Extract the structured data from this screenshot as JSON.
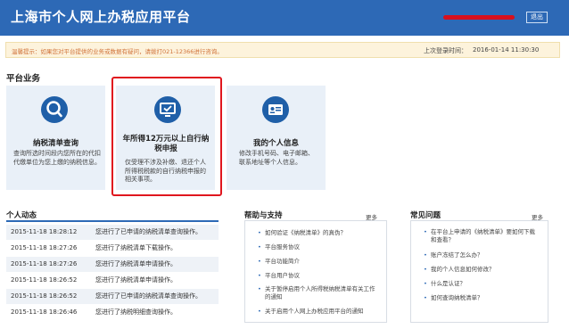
{
  "header": {
    "title": "上海市个人网上办税应用平台",
    "logout": "退出"
  },
  "notice": {
    "message": "温馨提示：如果您对平台提供的业务或数据有疑问，请拨打021-12366进行咨询。",
    "last_login_label": "上次登录时间：",
    "last_login_time": "2016-01-14 11:30:30"
  },
  "section_title": "平台业务",
  "cards": [
    {
      "title": "纳税清单查询",
      "desc": "查询所选时间段内您所在的代扣代缴单位为您上缴的纳税信息。",
      "icon": "magnifier-icon"
    },
    {
      "title": "年所得12万元以上自行纳税申报",
      "desc": "仅受理不涉及补缴、退还个人所得税税款的自行纳税申报的相关事项。",
      "icon": "monitor-check-icon"
    },
    {
      "title": "我的个人信息",
      "desc": "修改手机号码、电子邮箱、联系地址等个人信息。",
      "icon": "id-card-icon"
    }
  ],
  "activity": {
    "title": "个人动态",
    "rows": [
      {
        "time": "2015-11-18 18:28:12",
        "text": "您进行了已申请的纳税清单查询操作。"
      },
      {
        "time": "2015-11-18 18:27:26",
        "text": "您进行了纳税清单下载操作。"
      },
      {
        "time": "2015-11-18 18:27:26",
        "text": "您进行了纳税清单申请操作。"
      },
      {
        "time": "2015-11-18 18:26:52",
        "text": "您进行了纳税清单申请操作。"
      },
      {
        "time": "2015-11-18 18:26:52",
        "text": "您进行了已申请的纳税清单查询操作。"
      },
      {
        "time": "2015-11-18 18:26:46",
        "text": "您进行了纳税明细查询操作。"
      }
    ]
  },
  "help": {
    "title": "帮助与支持",
    "more": "更多",
    "items": [
      "如何验证《纳税清单》的真伪？",
      "平台服务协议",
      "平台功能简介",
      "平台用户协议",
      "关于暂停启用个人所得税纳税清单有关工作的通知",
      "关于启用个人网上办税应用平台的通知"
    ]
  },
  "faq": {
    "title": "常见问题",
    "more": "更多",
    "items": [
      "在平台上申请的《纳税清单》要如何下载和查看？",
      "账户冻结了怎么办？",
      "我的个人信息如何修改？",
      "什么是认证？",
      "如何查询纳税清单？"
    ]
  },
  "colors": {
    "header": "#2d69b6",
    "highlight": "#e0161e",
    "notice_bg": "#fdf3dc",
    "notice_text": "#d0733a"
  }
}
